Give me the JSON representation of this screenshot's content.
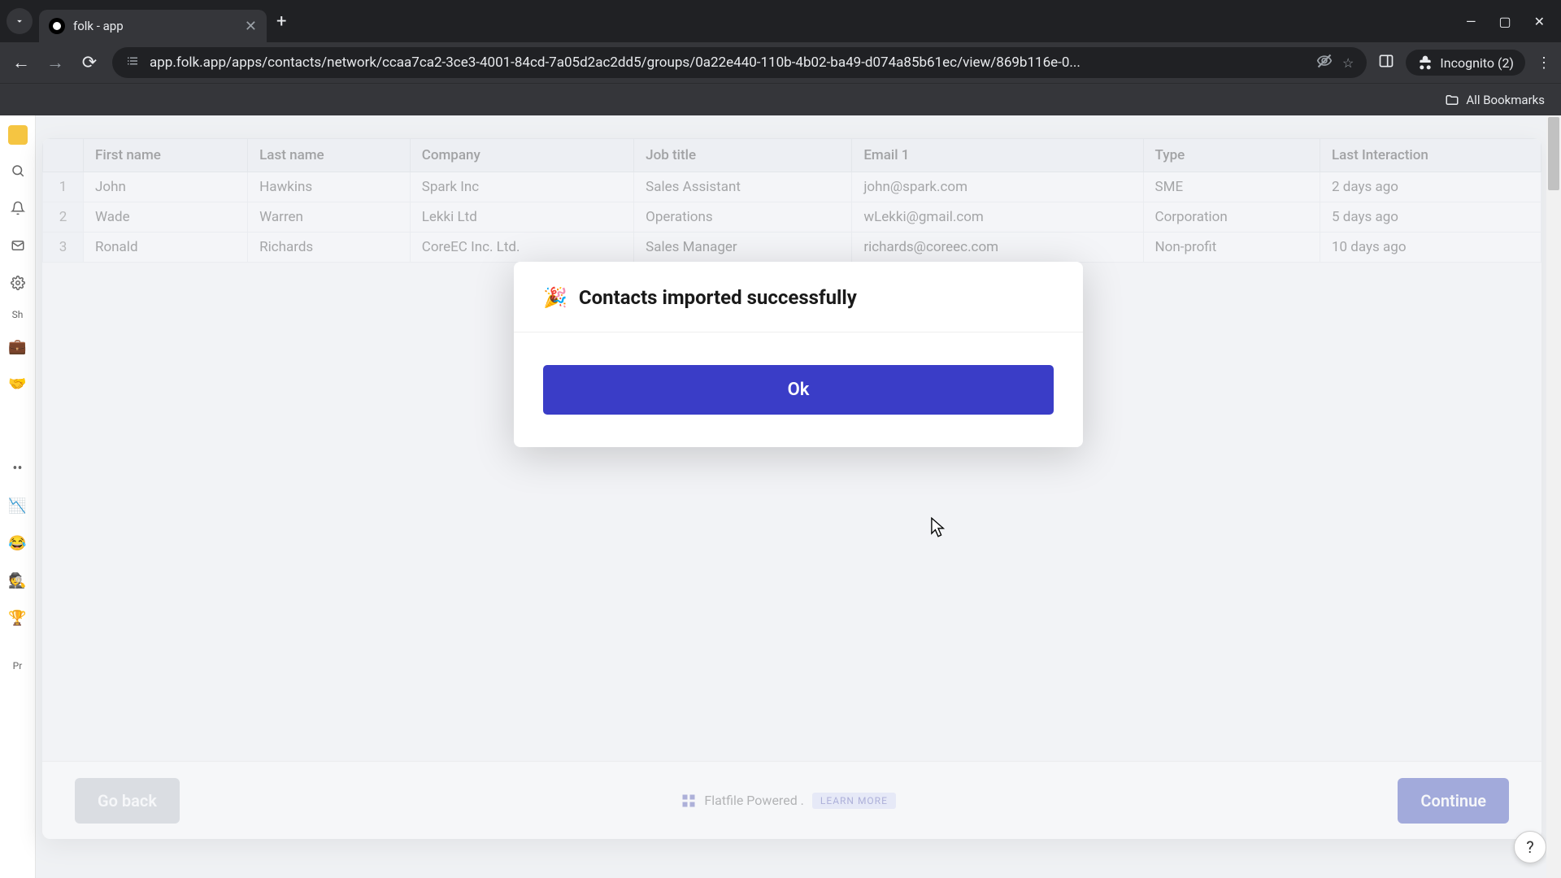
{
  "browser": {
    "tab_title": "folk - app",
    "url": "app.folk.app/apps/contacts/network/ccaa7ca2-3ce3-4001-84cd-7a05d2ac2dd5/groups/0a22e440-110b-4b02-ba49-d074a85b61ec/view/869b116e-0...",
    "incognito_label": "Incognito (2)",
    "all_bookmarks": "All Bookmarks"
  },
  "sidebar": {
    "shared_label": "Sh",
    "private_label": "Pr"
  },
  "table": {
    "headers": [
      "First name",
      "Last name",
      "Company",
      "Job title",
      "Email 1",
      "Type",
      "Last Interaction"
    ],
    "rows": [
      {
        "n": "1",
        "first": "John",
        "last": "Hawkins",
        "company": "Spark Inc",
        "job": "Sales Assistant",
        "email": "john@spark.com",
        "type": "SME",
        "last_inter": "2 days ago"
      },
      {
        "n": "2",
        "first": "Wade",
        "last": "Warren",
        "company": "Lekki Ltd",
        "job": "Operations",
        "email": "wLekki@gmail.com",
        "type": "Corporation",
        "last_inter": "5 days ago"
      },
      {
        "n": "3",
        "first": "Ronald",
        "last": "Richards",
        "company": "CoreEC Inc. Ltd.",
        "job": "Sales Manager",
        "email": "richards@coreec.com",
        "type": "Non-profit",
        "last_inter": "10 days ago"
      }
    ]
  },
  "footer": {
    "go_back": "Go back",
    "continue": "Continue",
    "powered": "Flatfile Powered .",
    "learn_more": "LEARN MORE"
  },
  "modal": {
    "title": "Contacts imported successfully",
    "ok": "Ok",
    "icon": "🎉"
  },
  "help": "?"
}
